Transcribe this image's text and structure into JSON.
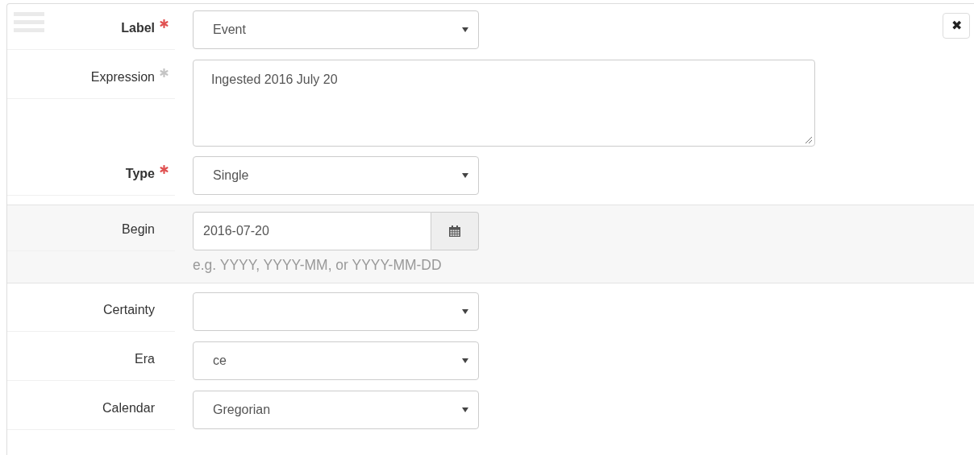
{
  "close_button": {
    "symbol": "✖"
  },
  "fields": [
    {
      "label": "Label",
      "required": true,
      "kind": "select",
      "value": "Event",
      "highlighted": false
    },
    {
      "label": "Expression",
      "recommended": true,
      "kind": "textarea",
      "value": "Ingested 2016 July 20",
      "highlighted": false
    },
    {
      "label": "Type",
      "required": true,
      "kind": "select",
      "value": "Single",
      "highlighted": false
    },
    {
      "label": "Begin",
      "kind": "date",
      "value": "2016-07-20",
      "help": "e.g. YYYY, YYYY-MM, or YYYY-MM-DD",
      "highlighted": true
    },
    {
      "label": "Certainty",
      "kind": "select",
      "highlighted": false
    },
    {
      "label": "Era",
      "kind": "select",
      "value": "ce",
      "highlighted": false
    },
    {
      "label": "Calendar",
      "kind": "select",
      "value": "Gregorian",
      "highlighted": false
    }
  ]
}
